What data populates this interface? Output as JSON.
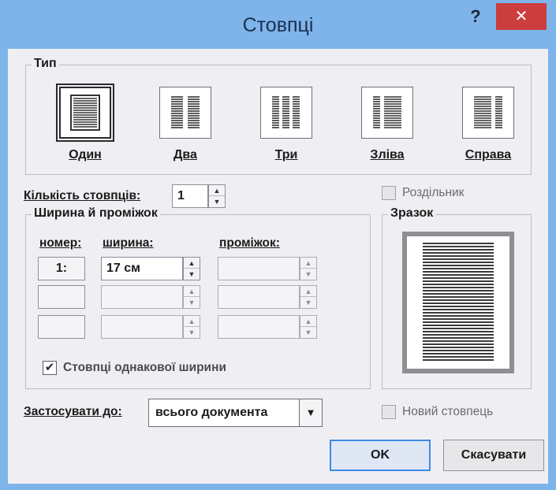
{
  "window": {
    "title": "Стовпці",
    "help_icon": "?",
    "close_icon": "✕"
  },
  "type_group": {
    "legend": "Тип",
    "presets": [
      {
        "label": "Один",
        "icon": "one-column-icon",
        "selected": true
      },
      {
        "label": "Два",
        "icon": "two-columns-icon",
        "selected": false
      },
      {
        "label": "Три",
        "icon": "three-columns-icon",
        "selected": false
      },
      {
        "label": "Зліва",
        "icon": "left-column-icon",
        "selected": false
      },
      {
        "label": "Справа",
        "icon": "right-column-icon",
        "selected": false
      }
    ]
  },
  "column_count": {
    "label": "Кількість стовпців:",
    "value": "1"
  },
  "separator": {
    "label": "Роздільник",
    "checked": false
  },
  "width_spacing": {
    "legend": "Ширина й проміжок",
    "header_number": "номер:",
    "header_width": "ширина:",
    "header_spacing": "проміжок:",
    "rows": [
      {
        "number": "1:",
        "width": "17 см",
        "spacing": ""
      },
      {
        "number": "",
        "width": "",
        "spacing": ""
      },
      {
        "number": "",
        "width": "",
        "spacing": ""
      }
    ],
    "equal_width": {
      "label": "Стовпці однакової ширини",
      "checked": true
    }
  },
  "preview": {
    "legend": "Зразок"
  },
  "apply_to": {
    "label": "Застосувати до:",
    "value": "всього документа"
  },
  "new_column": {
    "label": "Новий стовпець",
    "checked": false
  },
  "buttons": {
    "ok": "OK",
    "cancel": "Скасувати"
  },
  "colors": {
    "titlebar": "#7eb4ea",
    "close": "#cc3d3d",
    "default_button_border": "#3c8be3"
  }
}
